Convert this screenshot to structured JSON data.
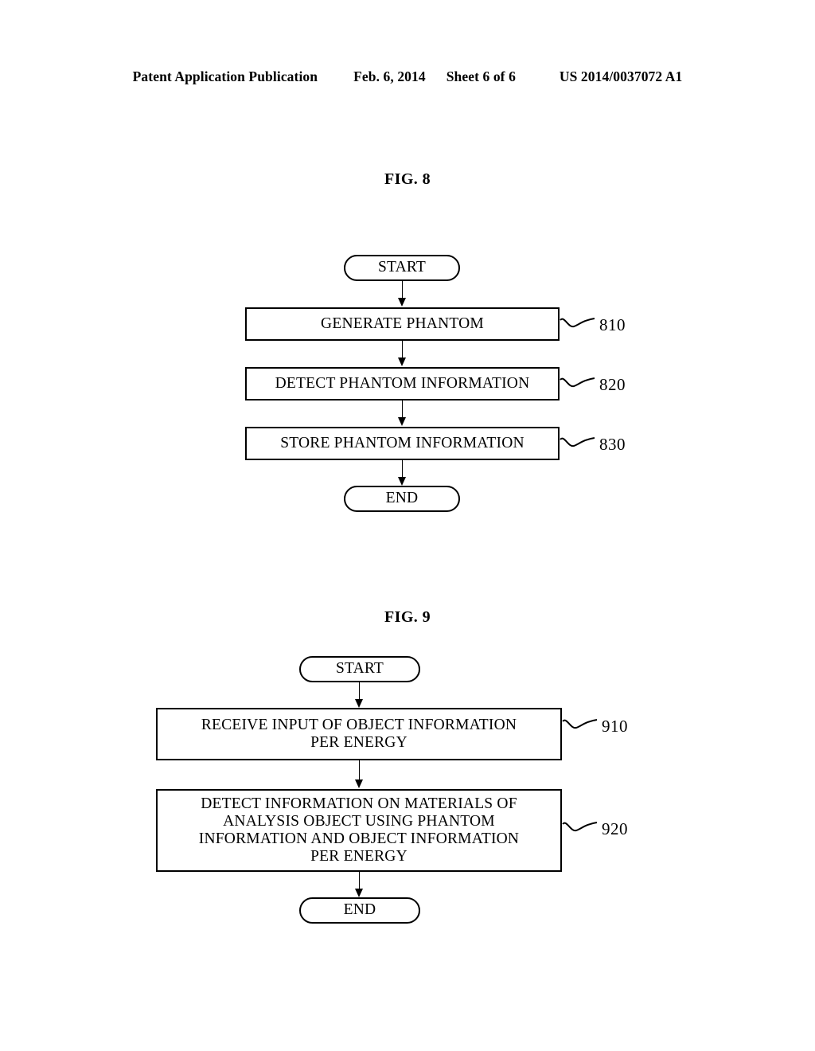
{
  "header": {
    "publication": "Patent Application Publication",
    "date": "Feb. 6, 2014",
    "sheet": "Sheet 6 of 6",
    "patent_number": "US 2014/0037072 A1"
  },
  "figures": [
    {
      "title": "FIG. 8",
      "nodes": [
        {
          "id": "fig8-start",
          "type": "terminal",
          "label": "START"
        },
        {
          "id": "fig8-810",
          "type": "process",
          "label": "GENERATE PHANTOM",
          "ref": "810"
        },
        {
          "id": "fig8-820",
          "type": "process",
          "label": "DETECT PHANTOM INFORMATION",
          "ref": "820"
        },
        {
          "id": "fig8-830",
          "type": "process",
          "label": "STORE PHANTOM INFORMATION",
          "ref": "830"
        },
        {
          "id": "fig8-end",
          "type": "terminal",
          "label": "END"
        }
      ]
    },
    {
      "title": "FIG. 9",
      "nodes": [
        {
          "id": "fig9-start",
          "type": "terminal",
          "label": "START"
        },
        {
          "id": "fig9-910",
          "type": "process",
          "label": "RECEIVE INPUT OF OBJECT INFORMATION PER ENERGY",
          "line1": "RECEIVE INPUT OF OBJECT INFORMATION",
          "line2": "PER ENERGY",
          "ref": "910"
        },
        {
          "id": "fig9-920",
          "type": "process",
          "label": "DETECT INFORMATION ON MATERIALS OF ANALYSIS OBJECT USING PHANTOM INFORMATION AND OBJECT INFORMATION PER ENERGY",
          "line1": "DETECT INFORMATION ON MATERIALS OF",
          "line2": "ANALYSIS OBJECT USING PHANTOM",
          "line3": "INFORMATION AND OBJECT INFORMATION",
          "line4": "PER ENERGY",
          "ref": "920"
        },
        {
          "id": "fig9-end",
          "type": "terminal",
          "label": "END"
        }
      ]
    }
  ],
  "colors": {
    "ink": "#000000",
    "paper": "#ffffff"
  }
}
